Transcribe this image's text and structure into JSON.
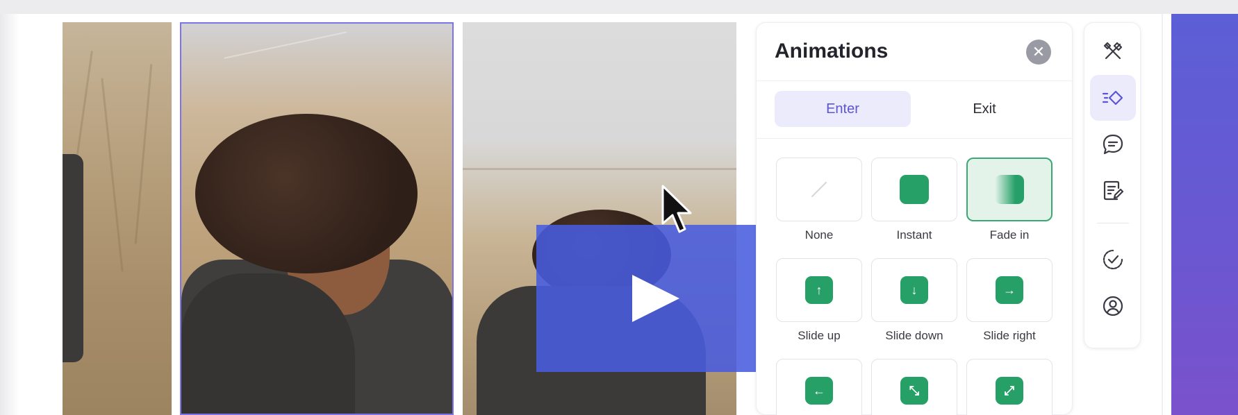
{
  "panel": {
    "title": "Animations",
    "close_icon": "close-icon"
  },
  "tabs": [
    {
      "label": "Enter",
      "active": true
    },
    {
      "label": "Exit",
      "active": false
    }
  ],
  "options": [
    {
      "label": "None",
      "icon": "none-icon",
      "glyph": "",
      "selected": false
    },
    {
      "label": "Instant",
      "icon": "instant-icon",
      "glyph": "",
      "selected": false
    },
    {
      "label": "Fade in",
      "icon": "fade-in-icon",
      "glyph": "",
      "selected": true
    },
    {
      "label": "Slide up",
      "icon": "arrow-up-icon",
      "glyph": "↑",
      "selected": false
    },
    {
      "label": "Slide down",
      "icon": "arrow-down-icon",
      "glyph": "↓",
      "selected": false
    },
    {
      "label": "Slide right",
      "icon": "arrow-right-icon",
      "glyph": "→",
      "selected": false
    },
    {
      "label": "",
      "icon": "arrow-left-icon",
      "glyph": "←",
      "selected": false
    },
    {
      "label": "",
      "icon": "expand-icon",
      "glyph": "⤡",
      "selected": false
    },
    {
      "label": "",
      "icon": "collapse-icon",
      "glyph": "⤢",
      "selected": false
    }
  ],
  "toolbar": [
    {
      "icon": "tools-icon",
      "active": false
    },
    {
      "icon": "animation-icon",
      "active": true
    },
    {
      "icon": "comment-icon",
      "active": false
    },
    {
      "icon": "notes-icon",
      "active": false
    },
    {
      "icon": "check-circle-icon",
      "active": false
    },
    {
      "icon": "user-circle-icon",
      "active": false
    }
  ],
  "overlay": {
    "icon": "play-icon"
  },
  "colors": {
    "accent": "#5c54d6",
    "green": "#26a067",
    "overlay": "#485cde",
    "selection_border": "#7a74e6"
  }
}
